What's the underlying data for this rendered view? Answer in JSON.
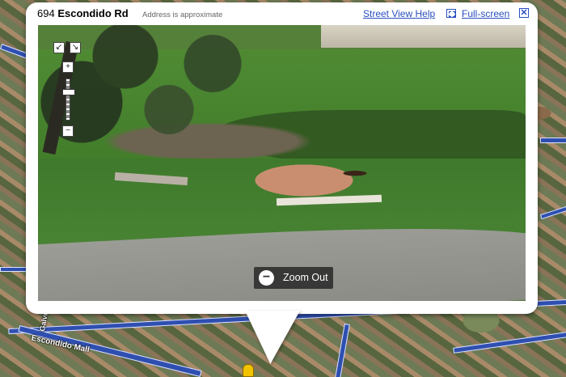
{
  "header": {
    "address_number": "694",
    "address_street": "Escondido Rd",
    "approx_note": "Address is approximate",
    "help_label": "Street View Help",
    "fullscreen_label": "Full-screen",
    "close_symbol": "✕"
  },
  "panorama": {
    "zoom_out_label": "Zoom Out",
    "zoom_out_symbol": "−",
    "nav": {
      "rotate_left_symbol": "↙",
      "rotate_right_symbol": "↘",
      "zoom_in_symbol": "+",
      "zoom_out_small_symbol": "−"
    }
  },
  "map": {
    "labels": [
      "Escondido Mall",
      "Galvez"
    ]
  },
  "colors": {
    "link": "#2a4fbf",
    "road": "#2f4fb0",
    "marker": "#f2c300"
  }
}
